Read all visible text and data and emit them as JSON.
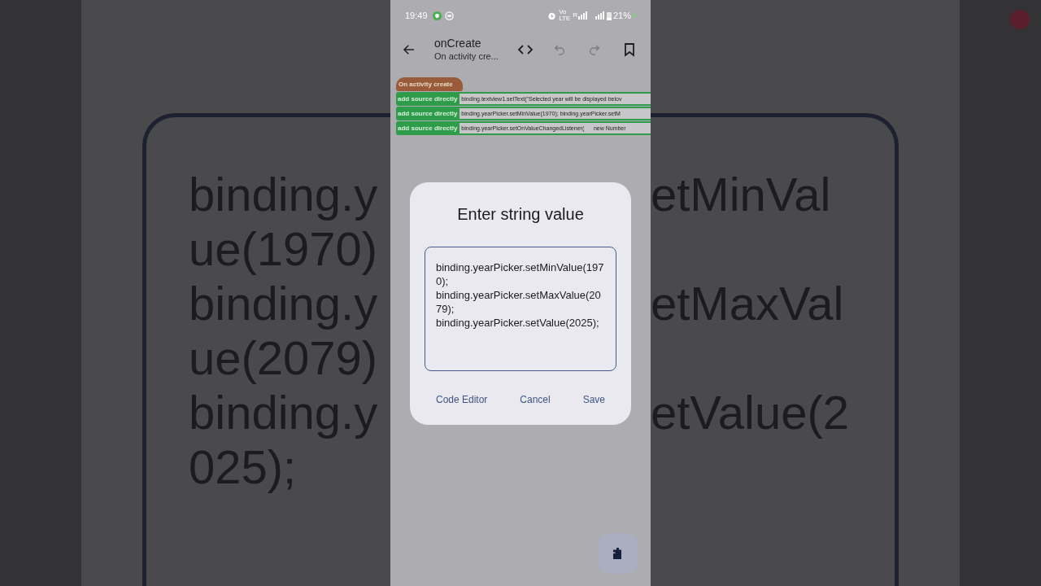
{
  "backdrop": {
    "left_lines": [
      "binding.y",
      "ue(1970)",
      "binding.y",
      "ue(2079)",
      "binding.y",
      "025);"
    ],
    "right_lines": [
      "etMinVal",
      "etMaxVal",
      "etValue(2"
    ]
  },
  "status_bar": {
    "time": "19:49",
    "network": "Vo LTE",
    "roaming": "R",
    "battery": "21%"
  },
  "toolbar": {
    "title": "onCreate",
    "subtitle": "On activity cre..."
  },
  "blocks": {
    "event": "On activity create",
    "rows": [
      {
        "label": "add source directly",
        "code": "binding.textview1.setText(\"Selected year will be displayed belov"
      },
      {
        "label": "add source directly",
        "code": "binding.yearPicker.setMinValue(1970); binding.yearPicker.setM"
      },
      {
        "label": "add source directly",
        "code": "binding.yearPicker.setOnValueChangedListener(      new Number"
      }
    ]
  },
  "dialog": {
    "title": "Enter string value",
    "value": "binding.yearPicker.setMinValue(1970);\nbinding.yearPicker.setMaxValue(2079);\nbinding.yearPicker.setValue(2025);",
    "buttons": [
      "Code Editor",
      "Cancel",
      "Save"
    ]
  }
}
